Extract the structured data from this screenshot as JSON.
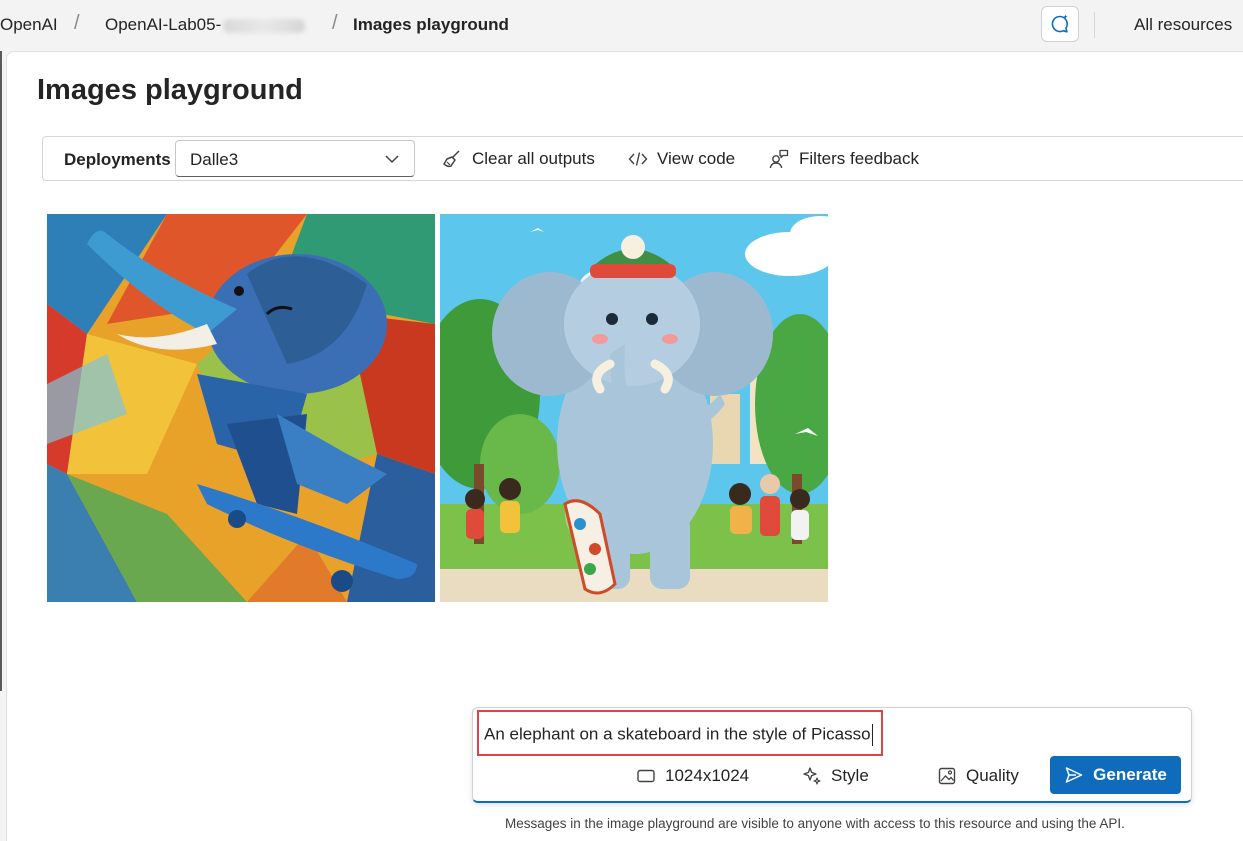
{
  "breadcrumb": {
    "root": "OpenAI",
    "resource": "OpenAI-Lab05-",
    "current": "Images playground"
  },
  "header": {
    "all_resources": "All resources"
  },
  "page": {
    "title": "Images playground"
  },
  "toolbar": {
    "deployments_label": "Deployments",
    "deployment_value": "Dalle3",
    "clear_outputs": "Clear all outputs",
    "view_code": "View code",
    "filters_feedback": "Filters feedback"
  },
  "images": [
    {
      "name": "picasso-elephant-skateboard",
      "icon": "generated-image"
    },
    {
      "name": "cartoon-elephant-park",
      "icon": "generated-image"
    }
  ],
  "prompt": {
    "value": "An elephant on a skateboard in the style of Picasso",
    "size": "1024x1024",
    "style": "Style",
    "quality": "Quality",
    "generate": "Generate"
  },
  "footer": {
    "note": "Messages in the image playground are visible to anyone with access to this resource and using the API."
  },
  "colors": {
    "accent": "#0f6cbd",
    "highlight": "#e0424c"
  }
}
